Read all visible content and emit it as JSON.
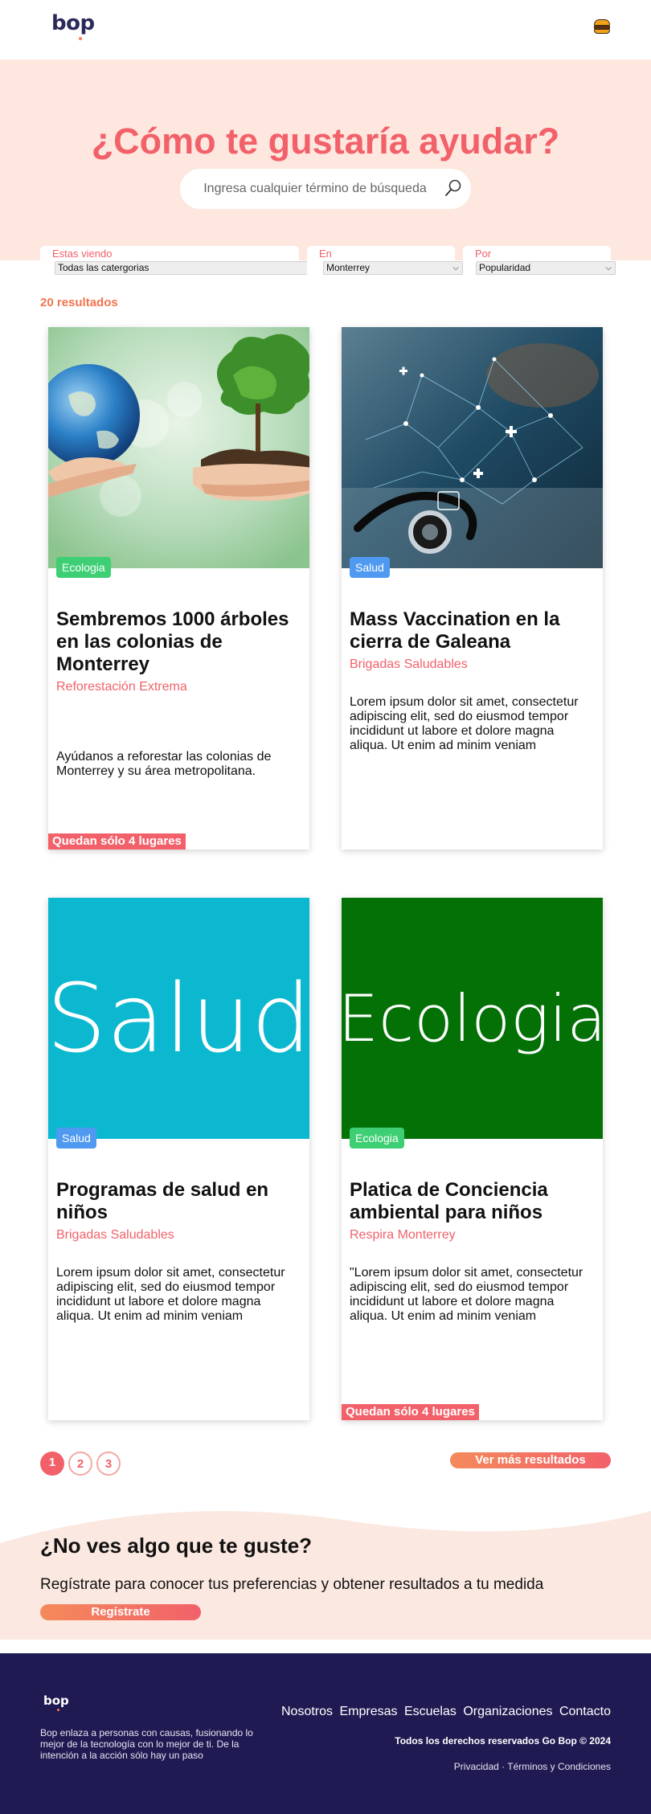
{
  "header": {
    "logo": "bop",
    "menu_icon": "burger-icon"
  },
  "hero": {
    "title": "¿Cómo te gustaría ayudar?",
    "search_placeholder": "Ingresa cualquier término de búsqueda",
    "search_icon": "search-icon"
  },
  "filters": [
    {
      "label": "Estas viendo",
      "value": "Todas las catergorias"
    },
    {
      "label": "En",
      "value": "Monterrey"
    },
    {
      "label": "Por",
      "value": "Popularidad"
    }
  ],
  "results": {
    "count_label": "20 resultados"
  },
  "cards": [
    {
      "tag": "Ecologia",
      "title": "Sembremos 1000 árboles en las colonias de Monterrey",
      "org": "Reforestación Extrema",
      "description": "Ayúdanos a reforestar las colonias de Monterrey y su área metropolitana.",
      "badge": "Quedan sólo 4 lugares"
    },
    {
      "tag": "Salud",
      "title": "Mass Vaccination en la cierra de Galeana",
      "org": "Brigadas Saludables",
      "description": "Lorem ipsum dolor sit amet, consectetur adipiscing elit, sed do eiusmod tempor incididunt ut labore et dolore magna aliqua. Ut enim ad minim veniam",
      "badge": ""
    },
    {
      "image_word": "Salud",
      "image_color": "#0bb8d0",
      "tag": "Salud",
      "title": "Programas de salud en niños",
      "org": "Brigadas Saludables",
      "description": "Lorem ipsum dolor sit amet, consectetur adipiscing elit, sed do eiusmod tempor incididunt ut labore et dolore magna aliqua. Ut enim ad minim veniam",
      "badge": ""
    },
    {
      "image_word": "Ecologia",
      "image_color": "#037106",
      "tag": "Ecologia",
      "title": "Platica de Conciencia ambiental para niños",
      "org": "Respira Monterrey",
      "description": "\"Lorem ipsum dolor sit amet, consectetur adipiscing elit, sed do eiusmod tempor incididunt ut labore et dolore magna aliqua. Ut enim ad minim veniam",
      "badge": "Quedan sólo 4 lugares"
    }
  ],
  "pagination": {
    "pages": [
      "1",
      "2",
      "3"
    ],
    "active": "1",
    "more_label": "Ver más resultados"
  },
  "cta": {
    "title": "¿No ves algo que te guste?",
    "text": "Regístrate para conocer tus preferencias y obtener resultados a tu medida",
    "button": "Regístrate"
  },
  "footer": {
    "logo": "bop",
    "description": "Bop enlaza a personas con causas, fusionando lo mejor de la tecnología con lo mejor de ti. De la intención a la acción sólo hay un paso",
    "nav": [
      "Nosotros",
      "Empresas",
      "Escuelas",
      "Organizaciones",
      "Contacto"
    ],
    "copyright": "Todos los derechos reservados Go Bop © 2024",
    "privacy": "Privacidad",
    "separator": "·",
    "terms": "Términos y Condiciones"
  },
  "colors": {
    "accent": "#f2616a",
    "hero_bg": "#fde7df",
    "footer_bg": "#201a52",
    "tag_green": "#3ecf74",
    "tag_blue": "#4f9af0"
  }
}
